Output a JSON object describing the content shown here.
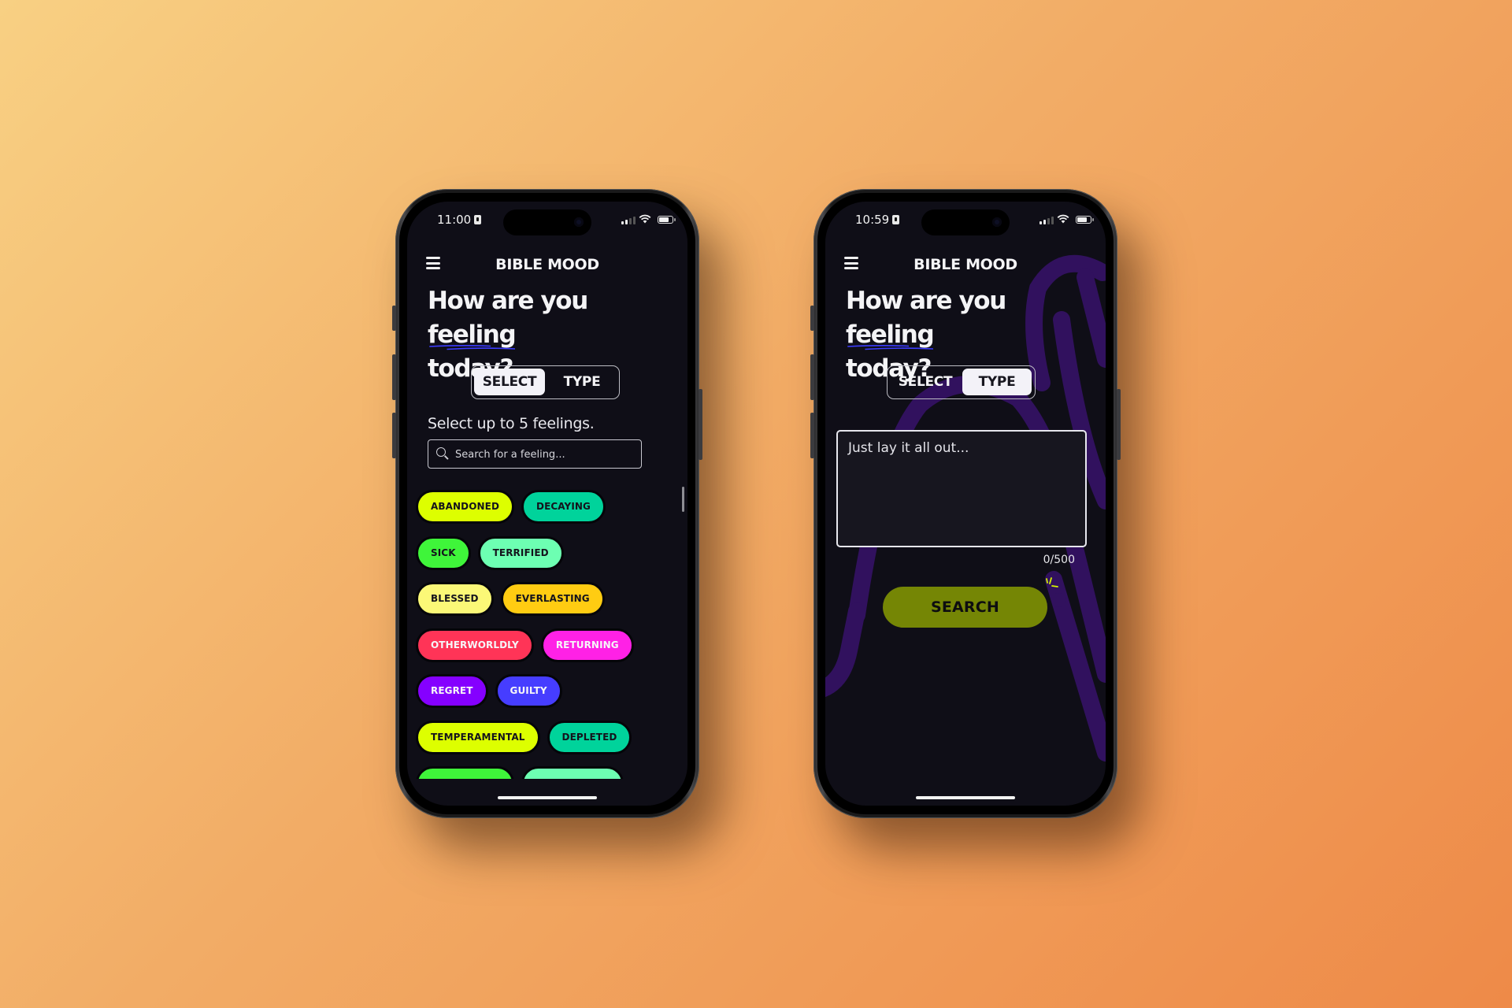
{
  "background": {
    "gradient_start": "#f8d083",
    "gradient_end": "#ee8a48"
  },
  "phones": [
    {
      "status": {
        "time": "11:00"
      },
      "app": {
        "title": "BIBLE MOOD"
      },
      "heading": {
        "prefix": "How are you ",
        "highlight": "feeling",
        "line2": "today?"
      },
      "segmented": {
        "options": [
          "SELECT",
          "TYPE"
        ],
        "active": "SELECT"
      },
      "helper_text": "Select up to 5 feelings.",
      "search": {
        "placeholder": "Search for a feeling...",
        "value": ""
      },
      "chips": [
        [
          {
            "label": "ABANDONED",
            "color": "#ddff00"
          },
          {
            "label": "DECAYING",
            "color": "#00d39b"
          }
        ],
        [
          {
            "label": "SICK",
            "color": "#3ff53a"
          },
          {
            "label": "TERRIFIED",
            "color": "#6dffb2"
          }
        ],
        [
          {
            "label": "BLESSED",
            "color": "#fbf877"
          },
          {
            "label": "EVERLASTING",
            "color": "#ffcc12"
          }
        ],
        [
          {
            "label": "OTHERWORLDLY",
            "color": "#ff3457"
          },
          {
            "label": "RETURNING",
            "color": "#ff21e6"
          }
        ],
        [
          {
            "label": "REGRET",
            "color": "#8500ff"
          },
          {
            "label": "GUILTY",
            "color": "#463dff"
          }
        ],
        [
          {
            "label": "TEMPERAMENTAL",
            "color": "#ddff00"
          },
          {
            "label": "DEPLETED",
            "color": "#00d39b"
          }
        ],
        [
          {
            "label": "",
            "color": "#3ff53a"
          },
          {
            "label": "",
            "color": "#6dffb2"
          }
        ]
      ]
    },
    {
      "status": {
        "time": "10:59"
      },
      "app": {
        "title": "BIBLE MOOD"
      },
      "heading": {
        "prefix": "How are you ",
        "highlight": "feeling",
        "line2": "today?"
      },
      "segmented": {
        "options": [
          "SELECT",
          "TYPE"
        ],
        "active": "TYPE"
      },
      "textarea": {
        "placeholder": "Just lay it all out...",
        "value": ""
      },
      "counter": "0/500",
      "search_button": "SEARCH",
      "accent": {
        "button": "#92a800",
        "decor": "#31115e",
        "underline": "#3b3bff"
      }
    }
  ]
}
